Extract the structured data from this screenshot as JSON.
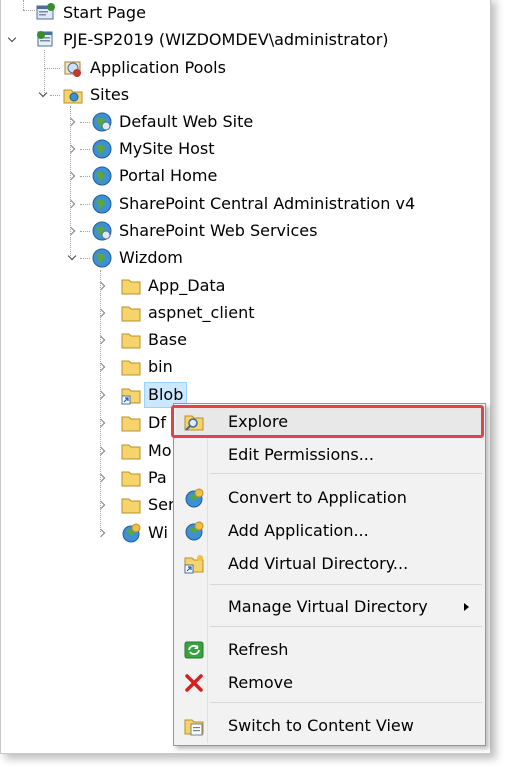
{
  "tree": {
    "start_page": "Start Page",
    "server": "PJE-SP2019 (WIZDOMDEV\\administrator)",
    "app_pools": "Application Pools",
    "sites": "Sites",
    "site_items": [
      "Default Web Site",
      "MySite Host",
      "Portal Home",
      "SharePoint Central Administration v4",
      "SharePoint Web Services",
      "Wizdom"
    ],
    "wizdom_children": [
      "App_Data",
      "aspnet_client",
      "Base",
      "bin",
      "Blob",
      "Df",
      "Mo",
      "Pa",
      "Ser",
      "Wi"
    ]
  },
  "context_menu": {
    "items": [
      "Explore",
      "Edit Permissions...",
      "Convert to Application",
      "Add Application...",
      "Add Virtual Directory...",
      "Manage Virtual Directory",
      "Refresh",
      "Remove",
      "Switch to Content View"
    ]
  },
  "colors": {
    "selection_bg": "#cce8ff",
    "highlight_border": "#e0444a",
    "menu_bg": "#f2f2f2"
  },
  "icons": {
    "start_page": "start-page-icon",
    "server": "server-icon",
    "app_pools": "application-pools-icon",
    "sites": "sites-folder-icon",
    "site": "globe-icon",
    "folder": "folder-icon",
    "virtual_dir": "virtual-directory-icon",
    "explore": "explore-icon",
    "refresh": "refresh-icon",
    "remove": "remove-icon",
    "content_view": "content-view-icon"
  }
}
